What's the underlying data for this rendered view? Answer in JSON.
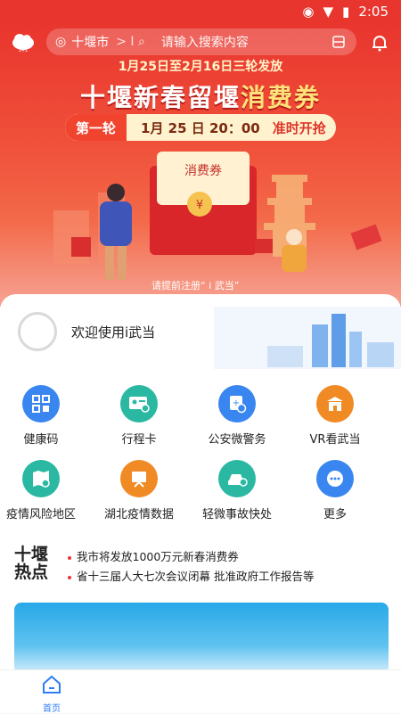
{
  "status": {
    "time": "2:05"
  },
  "search": {
    "city": "十堰市",
    "placeholder": "请输入搜索内容"
  },
  "hero": {
    "date_line": "1月25日至2月16日三轮发放",
    "title_a": "十堰新春留堰",
    "title_b": "消费券",
    "round_tag": "第一轮",
    "round_time": "1月 25 日 20：00",
    "round_go": "准时开抢",
    "coupon_label": "消费券",
    "hint": "请提前注册“ i 武当”"
  },
  "welcome": {
    "text": "欢迎使用i武当"
  },
  "services": [
    {
      "label": "健康码",
      "icon": "health-code-icon",
      "color": "#3a86f0"
    },
    {
      "label": "行程卡",
      "icon": "itinerary-card-icon",
      "color": "#2bb8a3"
    },
    {
      "label": "公安微警务",
      "icon": "police-service-icon",
      "color": "#3a86f0"
    },
    {
      "label": "VR看武当",
      "icon": "vr-temple-icon",
      "color": "#f08a24"
    },
    {
      "label": "疫情风险地区",
      "icon": "risk-area-icon",
      "color": "#2bb8a3"
    },
    {
      "label": "湖北疫情数据",
      "icon": "epidemic-data-icon",
      "color": "#f08a24"
    },
    {
      "label": "轻微事故快处",
      "icon": "car-accident-icon",
      "color": "#2bb8a3"
    },
    {
      "label": "更多",
      "icon": "more-icon",
      "color": "#3a86f0"
    }
  ],
  "news": {
    "logo_top": "十堰",
    "logo_bottom": "热点",
    "items": [
      "我市将发放1000万元新春消费券",
      "省十三届人大七次会议闭幕 批准政府工作报告等"
    ]
  },
  "tabbar": {
    "home": "首页"
  }
}
